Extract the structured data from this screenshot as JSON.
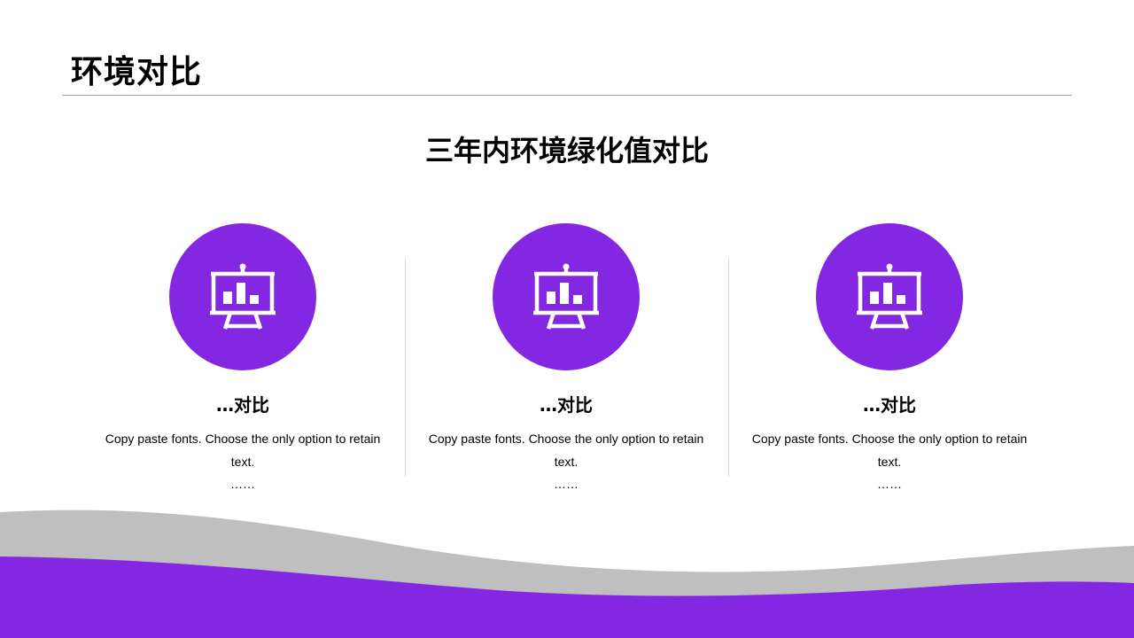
{
  "header": {
    "title": "环境对比"
  },
  "main": {
    "subtitle": "三年内环境绿化值对比",
    "cards": [
      {
        "icon": "presentation-chart-icon",
        "title": "…对比",
        "text": "Copy paste fonts. Choose the only option to retain text.",
        "more": "……"
      },
      {
        "icon": "presentation-chart-icon",
        "title": "…对比",
        "text": "Copy paste fonts. Choose the only option to retain text.",
        "more": "……"
      },
      {
        "icon": "presentation-chart-icon",
        "title": "…对比",
        "text": "Copy paste fonts. Choose the only option to retain text.",
        "more": "……"
      }
    ]
  },
  "colors": {
    "accent": "#8427e2",
    "wave_gray": "#bfbfbf",
    "rule": "#a6a6a6",
    "divider": "#d9d9d9"
  }
}
